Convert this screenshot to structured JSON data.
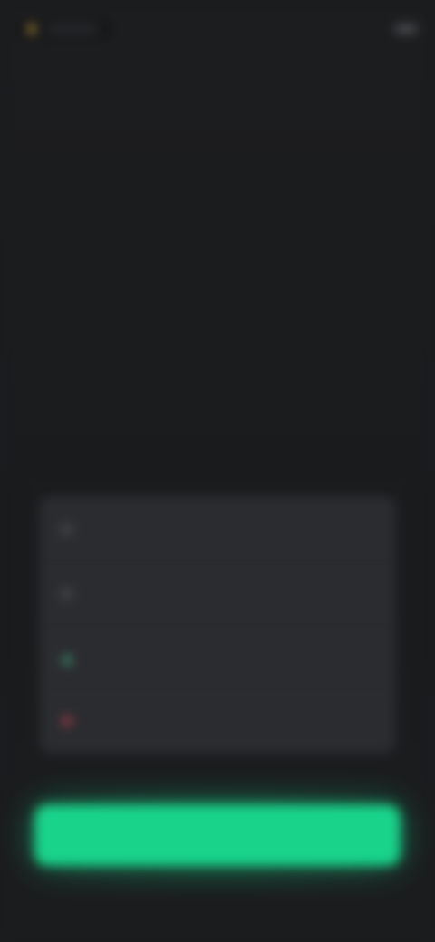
{
  "header": {
    "brand_name": "",
    "link_label": ""
  },
  "title_block": {
    "title": "",
    "subtitle": ""
  },
  "summary": {
    "rows": [
      {
        "icon": "info-icon",
        "label": "",
        "value": "",
        "tone": "neutral"
      },
      {
        "icon": "info-icon",
        "label": "",
        "value": "",
        "tone": "neutral"
      },
      {
        "icon": "up-icon",
        "label": "",
        "value": "",
        "tone": "positive"
      },
      {
        "icon": "down-icon",
        "label": "",
        "value": "",
        "tone": "negative"
      }
    ]
  },
  "cta": {
    "label": ""
  },
  "colors": {
    "background": "#1b1c1e",
    "card": "#2b2c2f",
    "accent": "#19d38a",
    "positive": "#3ecf93",
    "negative": "#e0576a"
  }
}
